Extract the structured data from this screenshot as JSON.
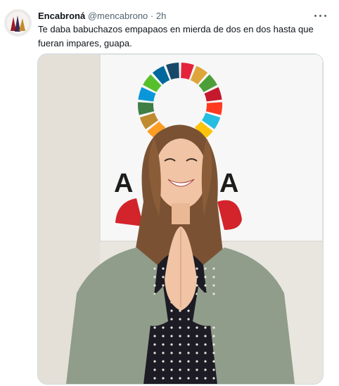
{
  "tweet": {
    "author_name": "Encabroná",
    "handle": "@mencabrono",
    "separator": "·",
    "time": "2h",
    "text": "Te daba babuchazos empapaos en mierda de dos en dos hasta que fueran impares, guapa."
  },
  "media": {
    "poster_letters": [
      "A",
      "A"
    ],
    "colors": {
      "sdg_wheel": [
        "#e5243b",
        "#dda63a",
        "#4c9f38",
        "#c5192d",
        "#ff3a21",
        "#26bde2",
        "#fcc30b",
        "#a21942",
        "#fd6925",
        "#dd1367",
        "#fd9d24",
        "#bf8b2e",
        "#3f7e44",
        "#0a97d9",
        "#56c02b",
        "#00689d",
        "#19486a"
      ],
      "background_wall": "#e9e6df",
      "cardigan": "#8f9d8a",
      "blouse": "#1d1b24",
      "hair": "#7a5233"
    }
  }
}
